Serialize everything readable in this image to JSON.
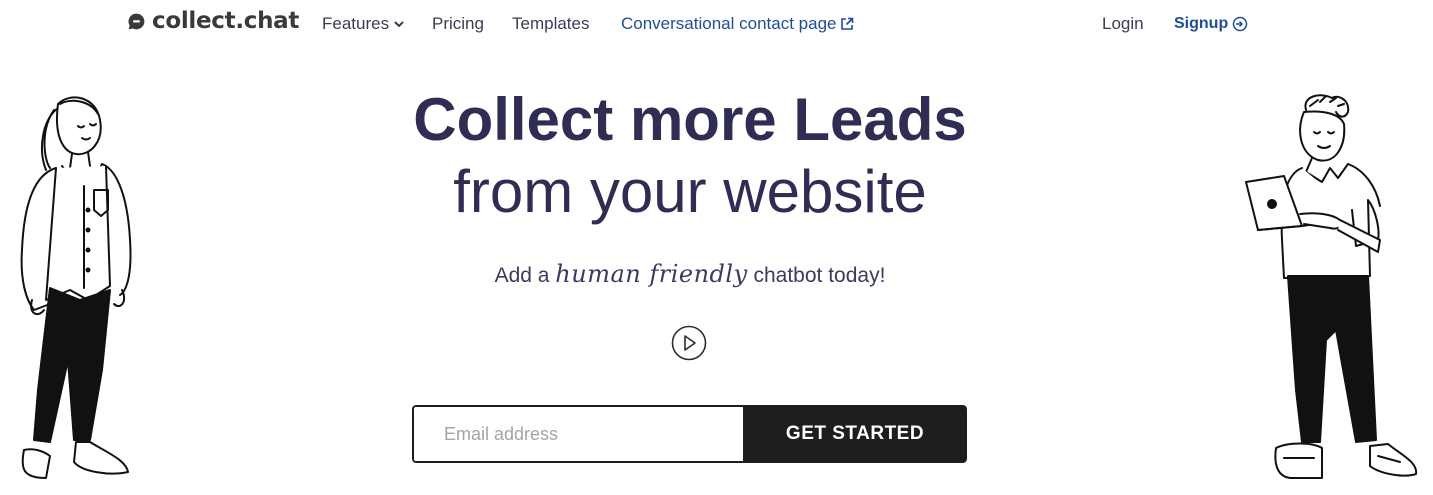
{
  "brand": {
    "name": "collect.chat",
    "icon": "chat-bubble-icon"
  },
  "nav": {
    "features": "Features",
    "pricing": "Pricing",
    "templates": "Templates",
    "contact_page": "Conversational contact page",
    "login": "Login",
    "signup": "Signup"
  },
  "hero": {
    "line1_prefix": "Collect more ",
    "line1_bold": "Leads",
    "line2": "from your website",
    "sub_prefix": "Add a ",
    "sub_script": "human friendly",
    "sub_suffix": " chatbot today!"
  },
  "form": {
    "email_placeholder": "Email address",
    "cta_label": "GET STARTED"
  },
  "icons": {
    "features_caret": "chevron-down-icon",
    "external": "external-link-icon",
    "signup": "login-arrow-icon",
    "play": "play-icon"
  },
  "colors": {
    "heading": "#302d55",
    "link_blue": "#1f4e95",
    "button_bg": "#1e1e1e"
  }
}
